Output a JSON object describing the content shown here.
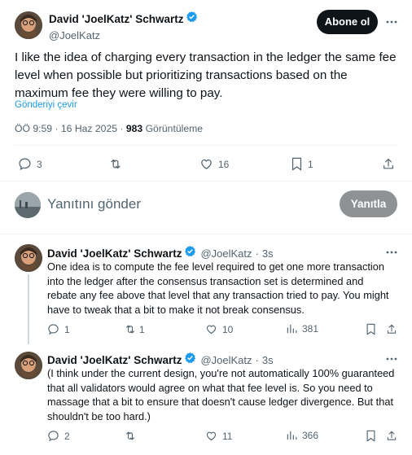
{
  "main_tweet": {
    "author_name": "David 'JoelKatz' Schwartz",
    "author_handle": "@JoelKatz",
    "follow_label": "Abone ol",
    "text": "I like the idea of charging every transaction in the ledger the same fee level when possible but prioritizing transactions based on the maximum fee they were willing to pay.",
    "translate_label": "Gönderiyi çevir",
    "time": "ÖÖ 9:59 · 16 Haz 2025 · ",
    "views_count": "983",
    "views_label": " Görüntüleme",
    "stats": {
      "replies": "3",
      "reposts": "",
      "likes": "16",
      "bookmarks": "1"
    }
  },
  "composer": {
    "placeholder": "Yanıtını gönder",
    "reply_button": "Yanıtla"
  },
  "replies": [
    {
      "author_name": "David 'JoelKatz' Schwartz",
      "author_handle": "@JoelKatz",
      "separator": "·",
      "age": "3s",
      "lines": [
        "One idea is to compute the fee level required to get one more transaction",
        "into the ledger after the consensus transaction set is determined and",
        "rebate any fee above that level that any transaction tried to pay. You might",
        "have to tweak that a bit to make it not break consensus."
      ],
      "stats": {
        "replies": "1",
        "reposts": "1",
        "likes": "10",
        "views": "381"
      }
    },
    {
      "author_name": "David 'JoelKatz' Schwartz",
      "author_handle": "@JoelKatz",
      "separator": "·",
      "age": "3s",
      "lines": [
        "(I think under the current design, you're not automatically 100% guaranteed",
        "that all validators would agree on what that fee level is. So you need to",
        "massage that a bit to ensure that doesn't cause ledger divergence. But that",
        "shouldn't be too hard.)"
      ],
      "stats": {
        "replies": "2",
        "reposts": "",
        "likes": "11",
        "views": "366"
      }
    }
  ],
  "colors": {
    "verified": "#1d9bf0",
    "link": "#1d9bf0",
    "muted": "#536471"
  }
}
